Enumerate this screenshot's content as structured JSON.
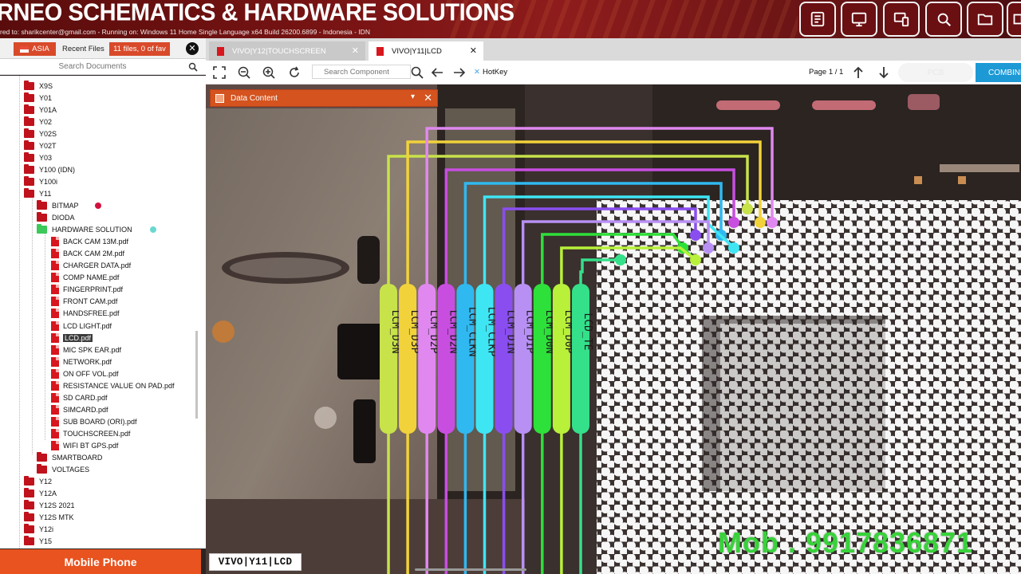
{
  "banner": {
    "title": "RNEO SCHEMATICS & HARDWARE SOLUTIONS",
    "subtitle": "red to: sharikcenter@gmail.com - Running on: Windows 11 Home Single Language x64 Build 26200.6899 - Indonesia - IDN",
    "buttons": [
      "report-icon",
      "monitor-icon",
      "devices-icon",
      "zoom-search-icon",
      "folder-icon",
      "more-icon"
    ]
  },
  "left_toolbar": {
    "region": "ASIA",
    "recent": "Recent Files",
    "fav": "11 files, 0 of fav"
  },
  "search_docs": {
    "placeholder": "Search Documents"
  },
  "tree": {
    "models_top": [
      "X9S",
      "Y01",
      "Y01A",
      "Y02",
      "Y02S",
      "Y02T",
      "Y03",
      "Y100 (IDN)",
      "Y100i",
      "Y11"
    ],
    "y11_children": [
      "BITMAP",
      "DIODA",
      "HARDWARE SOLUTION"
    ],
    "hardware_files": [
      "BACK CAM 13M.pdf",
      "BACK CAM 2M.pdf",
      "CHARGER DATA.pdf",
      "COMP NAME.pdf",
      "FINGERPRINT.pdf",
      "FRONT CAM.pdf",
      "HANDSFREE.pdf",
      "LCD LIGHT.pdf",
      "LCD.pdf",
      "MIC SPK EAR.pdf",
      "NETWORK.pdf",
      "ON OFF VOL.pdf",
      "RESISTANCE VALUE ON PAD.pdf",
      "SD CARD.pdf",
      "SIMCARD.pdf",
      "SUB BOARD (ORI).pdf",
      "TOUCHSCREEN.pdf",
      "WIFI BT GPS.pdf"
    ],
    "y11_after": [
      "SMARTBOARD",
      "VOLTAGES"
    ],
    "models_bottom": [
      "Y12",
      "Y12A",
      "Y12S 2021",
      "Y12S MTK",
      "Y12i",
      "Y15"
    ],
    "selected": "LCD.pdf"
  },
  "mobile_button": "Mobile Phone",
  "tabs": [
    {
      "label": "VIVO|Y12|TOUCHSCREEN",
      "active": false
    },
    {
      "label": "VIVO|Y11|LCD",
      "active": true
    }
  ],
  "toolbar": {
    "search_placeholder": "Search Component",
    "hotkey": "HotKey",
    "page": "Page 1 / 1",
    "pcb": "PCB",
    "combine": "COMBINE"
  },
  "data_panel": {
    "title": "Data Content"
  },
  "signals": [
    "LCM_D3N",
    "LCM_D3P",
    "LCM_D2P",
    "LCM_D2N",
    "LCM_CLKN",
    "LCM_CLKP",
    "LCM_D1N",
    "LCM_D1P",
    "LCM_D0N",
    "LCM_D0P",
    "LCD_TE"
  ],
  "signal_colors": [
    "#c8e24a",
    "#f1d23a",
    "#e088f0",
    "#c84ee0",
    "#30b8f0",
    "#3ee6f4",
    "#8a4ef0",
    "#b890f4",
    "#2ee03a",
    "#b8f03a",
    "#34e08a"
  ],
  "doc_label": "VIVO|Y11|LCD",
  "watermark": "Mob . 9917836871"
}
